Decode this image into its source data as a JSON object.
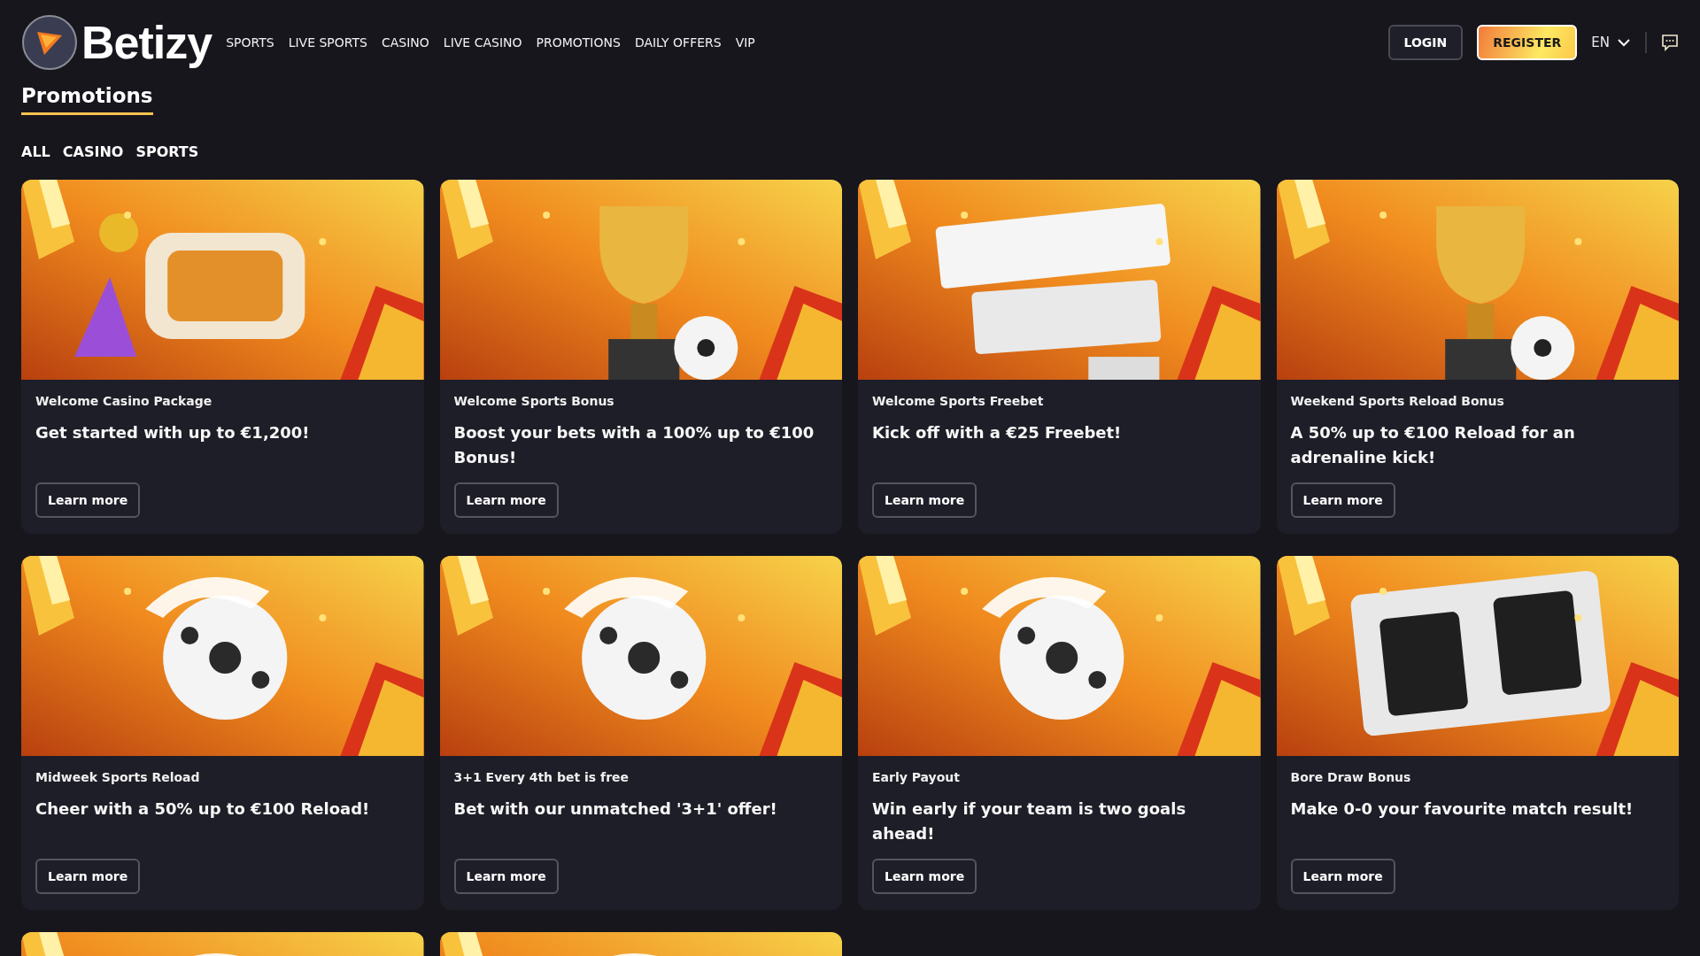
{
  "header": {
    "brand": "Betizy",
    "nav": [
      "SPORTS",
      "LIVE SPORTS",
      "CASINO",
      "LIVE CASINO",
      "PROMOTIONS",
      "DAILY OFFERS",
      "VIP"
    ],
    "login": "LOGIN",
    "register": "REGISTER",
    "language": "EN"
  },
  "page_title": "Promotions",
  "filters": [
    "ALL",
    "CASINO",
    "SPORTS"
  ],
  "promotions": [
    {
      "kind": "picture",
      "label": "Welcome Casino Package",
      "headline": "Get started with up to €1,200!",
      "button": "Learn more"
    },
    {
      "kind": "picture",
      "label": "Welcome Sports Bonus",
      "headline": "Boost your bets with a 100% up to €100 Bonus!",
      "button": "Learn more"
    },
    {
      "kind": "picture",
      "label": "Welcome Sports Freebet",
      "headline": "Kick off with a €25 Freebet!",
      "button": "Learn more"
    },
    {
      "kind": "picture",
      "label": "Weekend Sports Reload Bonus",
      "headline": "A 50% up to €100 Reload for an adrenaline kick!",
      "button": "Learn more"
    },
    {
      "kind": "picture",
      "label": "Midweek Sports Reload",
      "headline": "Cheer with a 50% up to €100 Reload!",
      "button": "Learn more"
    },
    {
      "kind": "picture",
      "label": "3+1 Every 4th bet is free",
      "headline": "Bet with our unmatched '3+1' offer!",
      "button": "Learn more"
    },
    {
      "kind": "picture",
      "label": "Early Payout",
      "headline": "Win early if your team is two goals ahead!",
      "button": "Learn more"
    },
    {
      "kind": "picture",
      "label": "Bore Draw Bonus",
      "headline": "Make 0-0 your favourite match result!",
      "button": "Learn more"
    }
  ]
}
